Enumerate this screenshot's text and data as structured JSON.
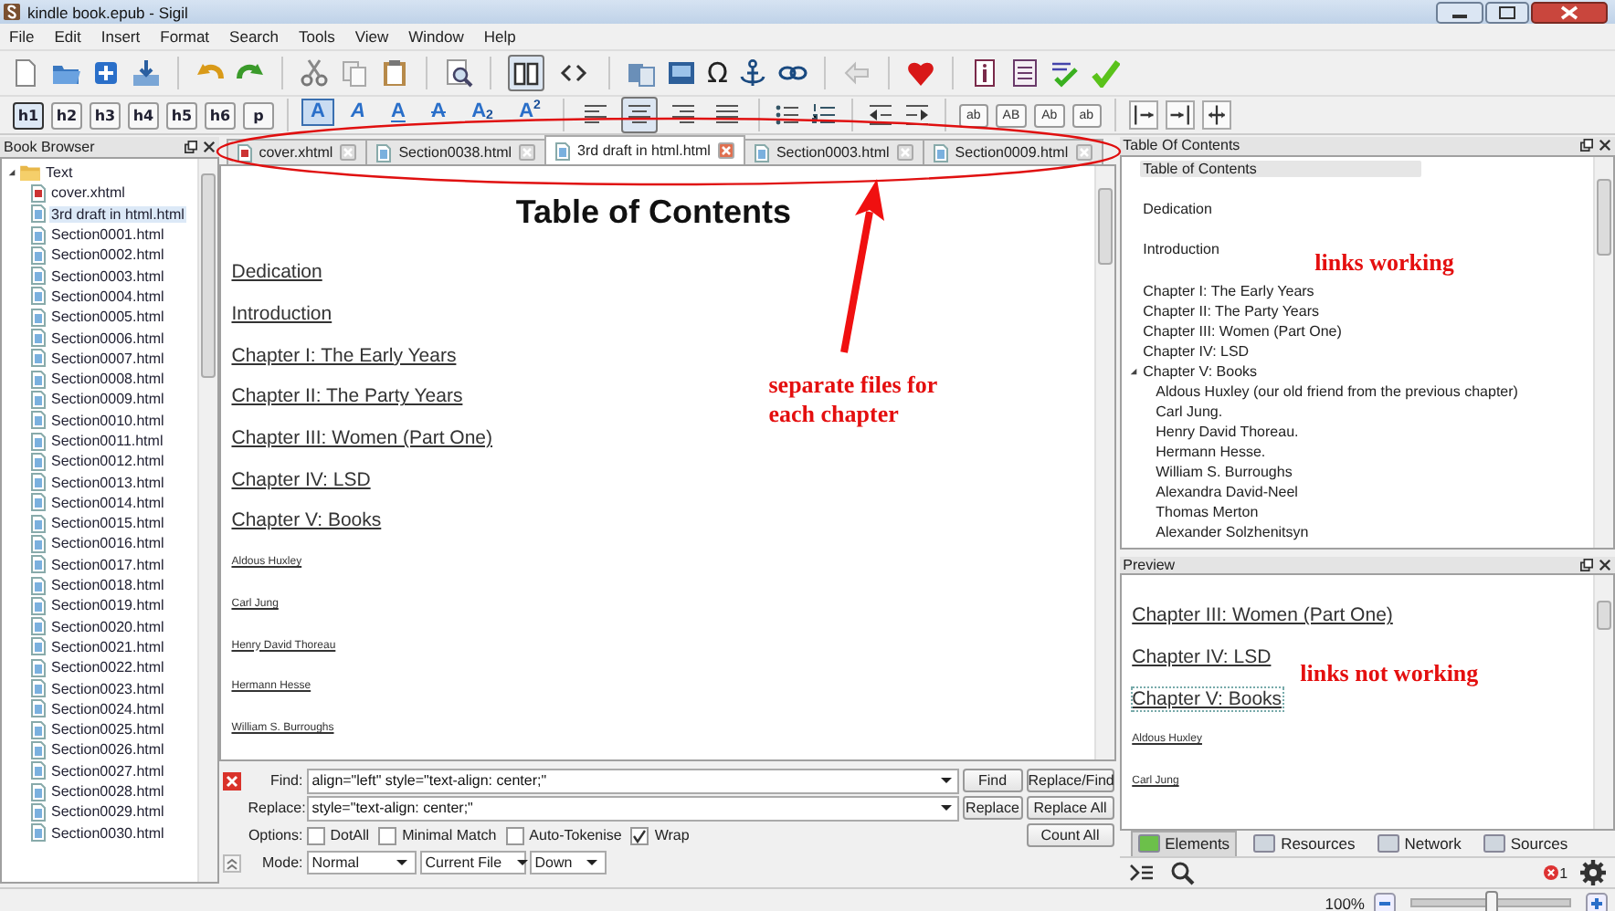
{
  "window": {
    "title": "kindle book.epub - Sigil"
  },
  "menu": [
    "File",
    "Edit",
    "Insert",
    "Format",
    "Search",
    "Tools",
    "View",
    "Window",
    "Help"
  ],
  "toolbar": {
    "view_modes": [
      {
        "selected": true
      },
      {
        "selected": false
      }
    ],
    "special_character": "Ω",
    "heading_buttons": [
      {
        "label": "h1",
        "selected": true
      },
      {
        "label": "h2",
        "selected": false
      },
      {
        "label": "h3",
        "selected": false
      },
      {
        "label": "h4",
        "selected": false
      },
      {
        "label": "h5",
        "selected": false
      },
      {
        "label": "h6",
        "selected": false
      },
      {
        "label": "p",
        "selected": false
      }
    ],
    "text_style_buttons": [
      {
        "label": "A",
        "kind": "bold",
        "selected": true
      },
      {
        "label": "A",
        "kind": "italic",
        "selected": false
      },
      {
        "label": "A",
        "kind": "underline",
        "selected": false
      },
      {
        "label": "A",
        "kind": "strike",
        "selected": false
      },
      {
        "label": "A$_{2}$",
        "kind": "subscript",
        "selected": false
      },
      {
        "label": "A$^{2}$",
        "kind": "superscript",
        "selected": false
      }
    ],
    "align_buttons": [
      {
        "selected": false
      },
      {
        "selected": true
      },
      {
        "selected": false
      },
      {
        "selected": false
      }
    ],
    "case_buttons": [
      "ab",
      "AB",
      "Ab",
      "ab"
    ]
  },
  "book_browser": {
    "title": "Book Browser",
    "tree": [
      {
        "label": "Text",
        "expanded": true,
        "children": [
          {
            "label": "cover.xhtml",
            "kind": "cover",
            "selected": false
          },
          {
            "label": "3rd draft in html.html",
            "kind": "page",
            "selected": true
          },
          {
            "label": "Section0001.html",
            "kind": "page",
            "selected": false
          },
          {
            "label": "Section0002.html",
            "kind": "page",
            "selected": false
          },
          {
            "label": "Section0003.html",
            "kind": "page",
            "selected": false
          },
          {
            "label": "Section0004.html",
            "kind": "page",
            "selected": false
          },
          {
            "label": "Section0005.html",
            "kind": "page",
            "selected": false
          },
          {
            "label": "Section0006.html",
            "kind": "page",
            "selected": false
          },
          {
            "label": "Section0007.html",
            "kind": "page",
            "selected": false
          },
          {
            "label": "Section0008.html",
            "kind": "page",
            "selected": false
          },
          {
            "label": "Section0009.html",
            "kind": "page",
            "selected": false
          },
          {
            "label": "Section0010.html",
            "kind": "page",
            "selected": false
          },
          {
            "label": "Section0011.html",
            "kind": "page",
            "selected": false
          },
          {
            "label": "Section0012.html",
            "kind": "page",
            "selected": false
          },
          {
            "label": "Section0013.html",
            "kind": "page",
            "selected": false
          },
          {
            "label": "Section0014.html",
            "kind": "page",
            "selected": false
          },
          {
            "label": "Section0015.html",
            "kind": "page",
            "selected": false
          },
          {
            "label": "Section0016.html",
            "kind": "page",
            "selected": false
          },
          {
            "label": "Section0017.html",
            "kind": "page",
            "selected": false
          },
          {
            "label": "Section0018.html",
            "kind": "page",
            "selected": false
          },
          {
            "label": "Section0019.html",
            "kind": "page",
            "selected": false
          },
          {
            "label": "Section0020.html",
            "kind": "page",
            "selected": false
          },
          {
            "label": "Section0021.html",
            "kind": "page",
            "selected": false
          },
          {
            "label": "Section0022.html",
            "kind": "page",
            "selected": false
          },
          {
            "label": "Section0023.html",
            "kind": "page",
            "selected": false
          },
          {
            "label": "Section0024.html",
            "kind": "page",
            "selected": false
          },
          {
            "label": "Section0025.html",
            "kind": "page",
            "selected": false
          },
          {
            "label": "Section0026.html",
            "kind": "page",
            "selected": false
          },
          {
            "label": "Section0027.html",
            "kind": "page",
            "selected": false
          },
          {
            "label": "Section0028.html",
            "kind": "page",
            "selected": false
          },
          {
            "label": "Section0029.html",
            "kind": "page",
            "selected": false
          },
          {
            "label": "Section0030.html",
            "kind": "page",
            "selected": false
          }
        ]
      }
    ]
  },
  "tabs": [
    {
      "label": "cover.xhtml",
      "kind": "cover",
      "selected": false
    },
    {
      "label": "Section0038.html",
      "kind": "page",
      "selected": false
    },
    {
      "label": "3rd draft in html.html",
      "kind": "page",
      "selected": true
    },
    {
      "label": "Section0003.html",
      "kind": "page",
      "selected": false
    },
    {
      "label": "Section0009.html",
      "kind": "page",
      "selected": false
    }
  ],
  "editor": {
    "heading": "Table of Contents",
    "links": [
      {
        "text": "Dedication",
        "kind": "chapter"
      },
      {
        "text": "Introduction",
        "kind": "chapter"
      },
      {
        "text": "Chapter I: The Early Years",
        "kind": "chapter"
      },
      {
        "text": "Chapter II: The Party Years",
        "kind": "chapter"
      },
      {
        "text": "Chapter III: Women (Part One)",
        "kind": "chapter"
      },
      {
        "text": "Chapter IV: LSD",
        "kind": "chapter"
      },
      {
        "text": "Chapter V: Books",
        "kind": "chapter"
      },
      {
        "text": "Aldous Huxley",
        "kind": "person"
      },
      {
        "text": "Carl Jung",
        "kind": "person"
      },
      {
        "text": "Henry David Thoreau",
        "kind": "person"
      },
      {
        "text": "Hermann Hesse",
        "kind": "person"
      },
      {
        "text": "William S. Burroughs",
        "kind": "person"
      }
    ]
  },
  "find_panel": {
    "find_label": "Find:",
    "find_value": "align=\"left\" style=\"text-align: center;\"",
    "replace_label": "Replace:",
    "replace_value": "style=\"text-align: center;\"",
    "options_label": "Options:",
    "options": [
      {
        "label": "DotAll",
        "checked": false
      },
      {
        "label": "Minimal Match",
        "checked": false
      },
      {
        "label": "Auto-Tokenise",
        "checked": false
      },
      {
        "label": "Wrap",
        "checked": true
      }
    ],
    "mode_label": "Mode:",
    "dropdowns": [
      "Normal",
      "Current File",
      "Down"
    ],
    "buttons": [
      "Find",
      "Replace/Find",
      "Replace",
      "Replace All",
      "Count All"
    ]
  },
  "toc_panel": {
    "title": "Table Of Contents",
    "entries": [
      {
        "label": "Table of Contents",
        "selected": true
      },
      {
        "label": "Dedication",
        "selected": false
      },
      {
        "label": "Introduction",
        "selected": false
      },
      {
        "label": "Chapter I: The Early Years",
        "selected": false
      },
      {
        "label": "Chapter II: The Party Years",
        "selected": false
      },
      {
        "label": "Chapter III: Women (Part One)",
        "selected": false
      },
      {
        "label": "Chapter IV: LSD",
        "selected": false
      },
      {
        "label": "Chapter V: Books",
        "selected": false,
        "expanded": true,
        "children": [
          {
            "label": "Aldous Huxley (our old friend from the previous chapter)",
            "selected": false
          },
          {
            "label": "Carl Jung.",
            "selected": false
          },
          {
            "label": "Henry David Thoreau.",
            "selected": false
          },
          {
            "label": "Hermann Hesse.",
            "selected": false
          },
          {
            "label": "William S. Burroughs",
            "selected": false
          },
          {
            "label": "Alexandra David-Neel",
            "selected": false
          },
          {
            "label": "Thomas Merton",
            "selected": false
          },
          {
            "label": "Alexander Solzhenitsyn",
            "selected": false
          }
        ]
      }
    ]
  },
  "preview_panel": {
    "title": "Preview",
    "links": [
      {
        "text": "Chapter III: Women (Part One)",
        "kind": "chapter",
        "focused": false
      },
      {
        "text": "Chapter IV: LSD",
        "kind": "chapter",
        "focused": false
      },
      {
        "text": "Chapter V: Books",
        "kind": "chapter",
        "focused": true
      },
      {
        "text": "Aldous Huxley",
        "kind": "person",
        "focused": false
      },
      {
        "text": "Carl Jung",
        "kind": "person",
        "focused": false
      }
    ],
    "inspector_tabs": [
      {
        "label": "Elements",
        "selected": true
      },
      {
        "label": "Resources",
        "selected": false
      },
      {
        "label": "Network",
        "selected": false
      },
      {
        "label": "Sources",
        "selected": false
      }
    ],
    "error_count": "1"
  },
  "status_bar": {
    "zoom": "100%",
    "level": 0.5
  },
  "annotations": {
    "tabs_note": [
      "separate files for",
      "each chapter"
    ],
    "toc_note": "links working",
    "preview_note": "links not working"
  }
}
